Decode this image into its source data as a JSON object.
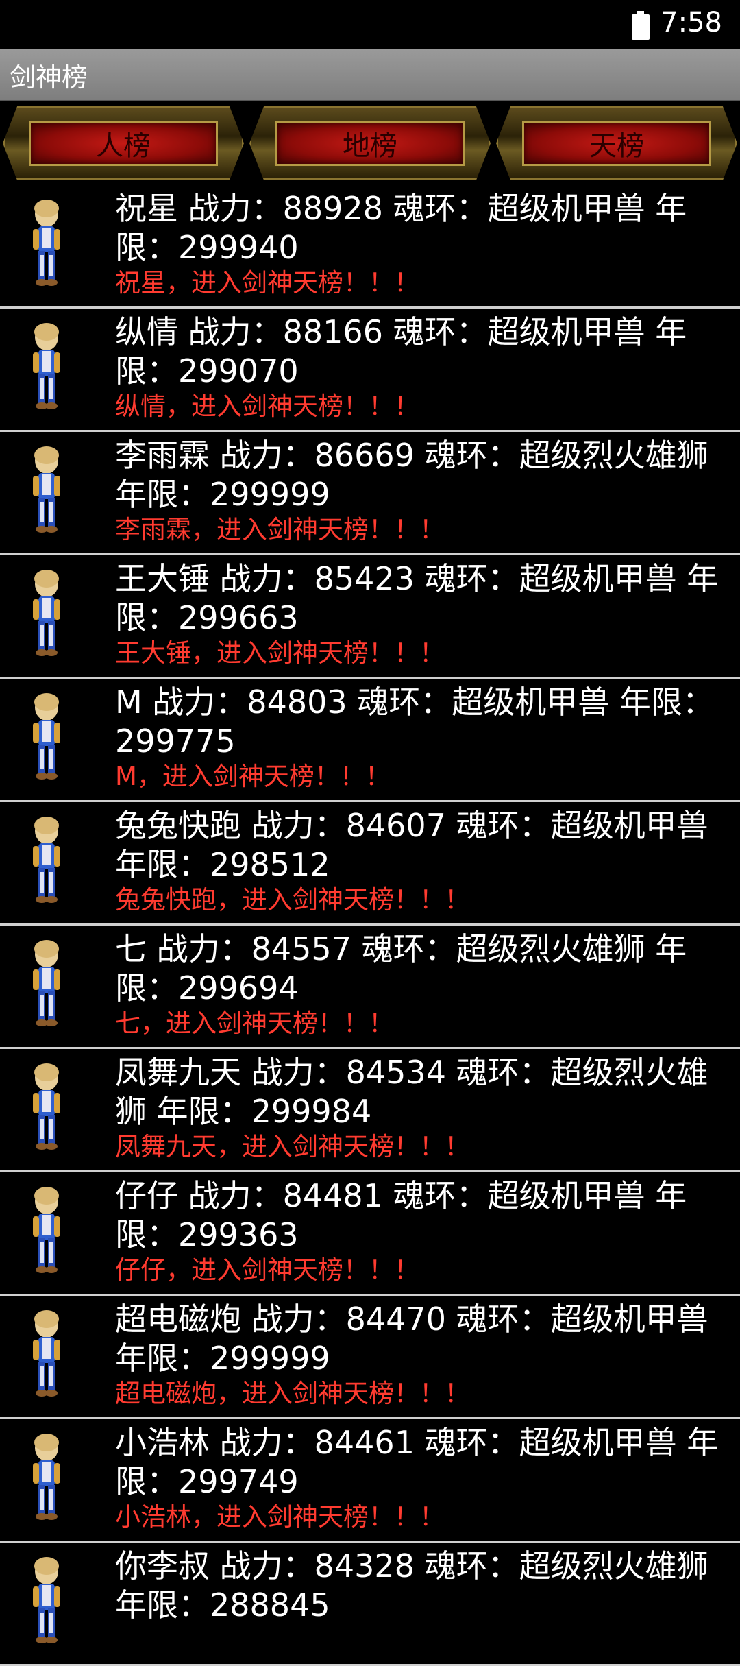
{
  "status": {
    "time": "7:58"
  },
  "header": {
    "title": "剑神榜"
  },
  "tabs": [
    {
      "label": "人榜"
    },
    {
      "label": "地榜"
    },
    {
      "label": "天榜"
    }
  ],
  "list": [
    {
      "info": "祝星 战力：88928 魂环：超级机甲兽 年限：299940",
      "msg": "祝星，进入剑神天榜！！！"
    },
    {
      "info": "纵情 战力：88166 魂环：超级机甲兽 年限：299070",
      "msg": "纵情，进入剑神天榜！！！"
    },
    {
      "info": "李雨霖 战力：86669 魂环：超级烈火雄狮 年限：299999",
      "msg": "李雨霖，进入剑神天榜！！！"
    },
    {
      "info": "王大锤 战力：85423 魂环：超级机甲兽 年限：299663",
      "msg": "王大锤，进入剑神天榜！！！"
    },
    {
      "info": "M 战力：84803 魂环：超级机甲兽 年限：299775",
      "msg": "M，进入剑神天榜！！！"
    },
    {
      "info": "兔兔快跑 战力：84607 魂环：超级机甲兽 年限：298512",
      "msg": "兔兔快跑，进入剑神天榜！！！"
    },
    {
      "info": "七 战力：84557 魂环：超级烈火雄狮 年限：299694",
      "msg": "七，进入剑神天榜！！！"
    },
    {
      "info": "凤舞九天 战力：84534 魂环：超级烈火雄狮 年限：299984",
      "msg": "凤舞九天，进入剑神天榜！！！"
    },
    {
      "info": "仔仔 战力：84481 魂环：超级机甲兽 年限：299363",
      "msg": "仔仔，进入剑神天榜！！！"
    },
    {
      "info": "超电磁炮 战力：84470 魂环：超级机甲兽 年限：299999",
      "msg": "超电磁炮，进入剑神天榜！！！"
    },
    {
      "info": "小浩林 战力：84461 魂环：超级机甲兽 年限：299749",
      "msg": "小浩林，进入剑神天榜！！！"
    },
    {
      "info": "你李叔 战力：84328 魂环：超级烈火雄狮 年限：288845",
      "msg": ""
    }
  ]
}
